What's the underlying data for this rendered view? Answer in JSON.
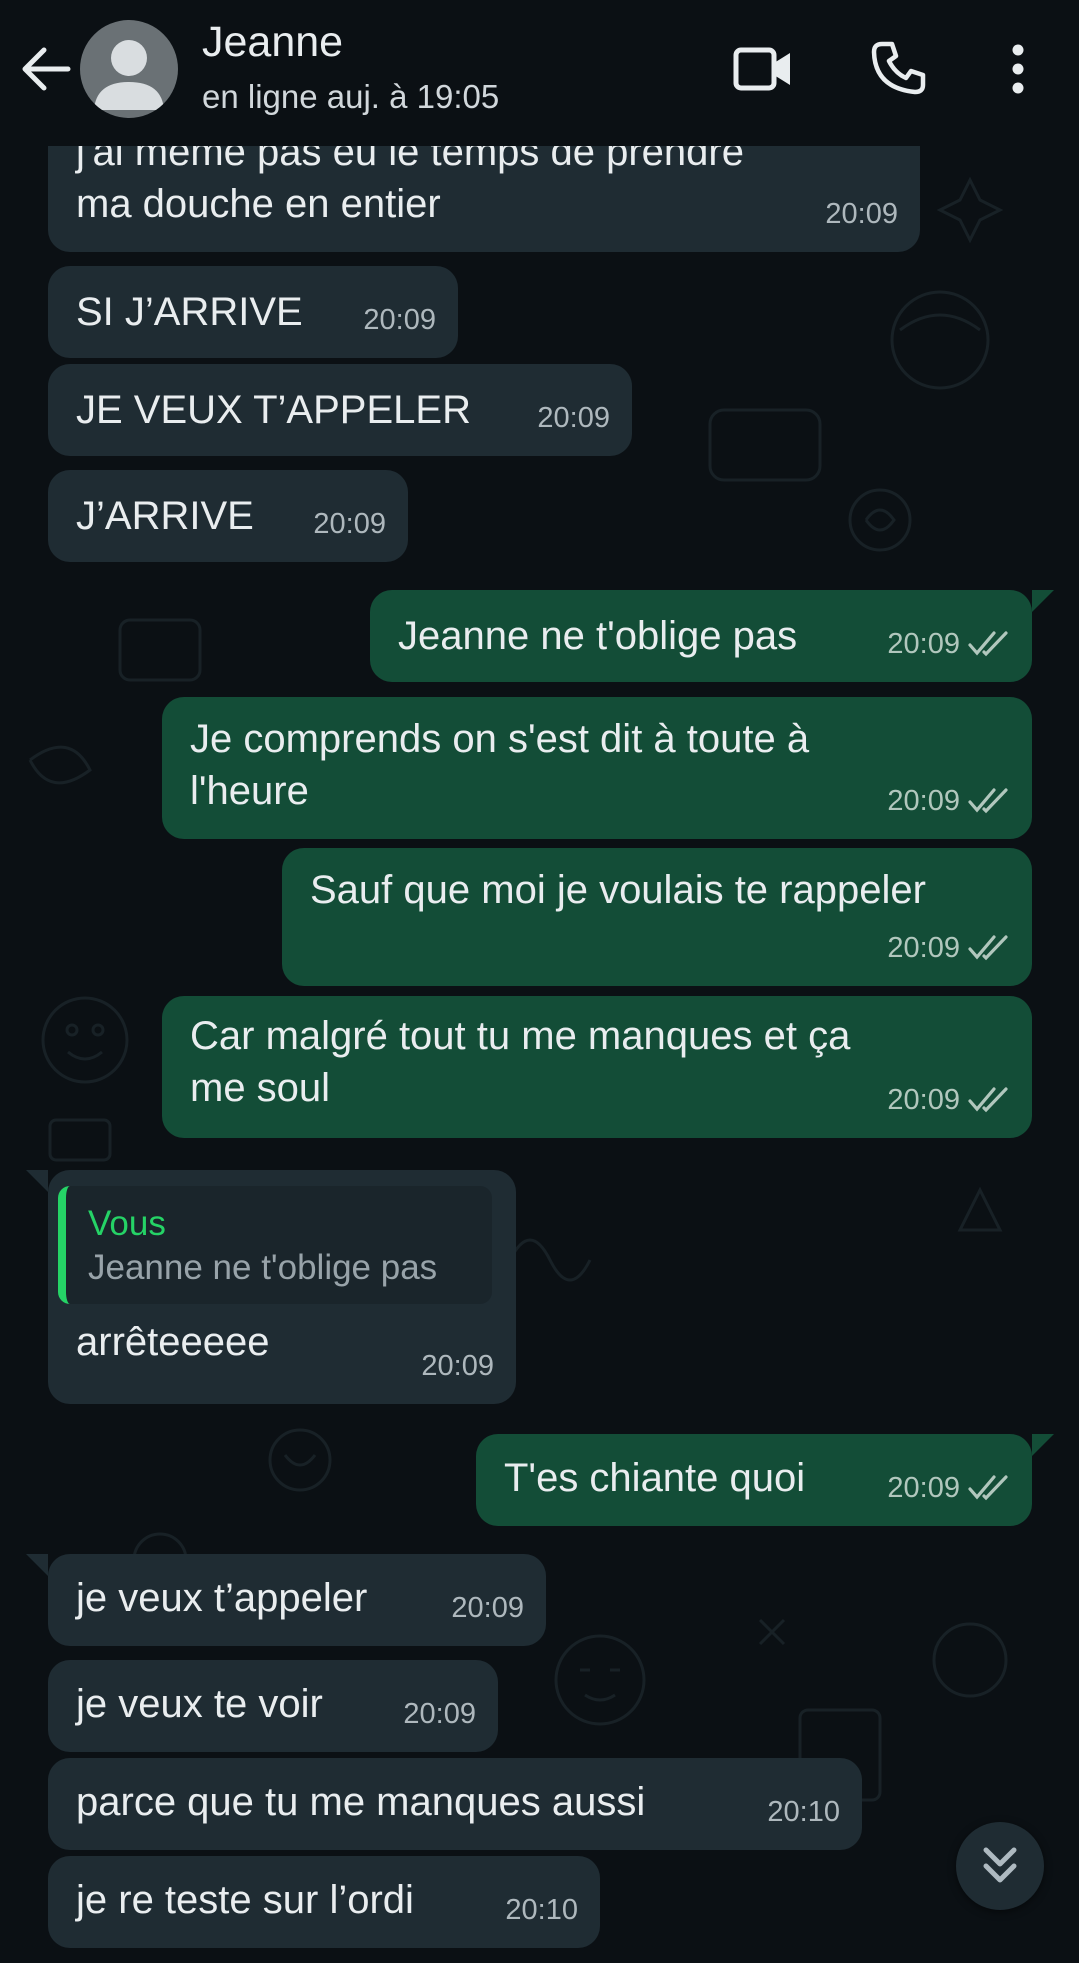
{
  "header": {
    "contact_name": "Jeanne",
    "status": "en ligne auj. à 19:05",
    "icons": [
      "back-arrow-icon",
      "avatar",
      "video-call-icon",
      "phone-call-icon",
      "more-options-icon"
    ]
  },
  "messages": [
    {
      "direction": "in",
      "lines": [
        "j'ai même pas eu le temps de prendre",
        "ma douche en entier"
      ],
      "time": "20:09"
    },
    {
      "direction": "in",
      "lines": [
        "SI J’ARRIVE"
      ],
      "time": "20:09"
    },
    {
      "direction": "in",
      "lines": [
        "JE VEUX T’APPELER"
      ],
      "time": "20:09"
    },
    {
      "direction": "in",
      "lines": [
        "J’ARRIVE"
      ],
      "time": "20:09"
    },
    {
      "direction": "out",
      "lines": [
        "Jeanne ne t'oblige pas"
      ],
      "time": "20:09",
      "status": "read"
    },
    {
      "direction": "out",
      "lines": [
        "Je comprends on s'est dit à toute à",
        "l'heure"
      ],
      "time": "20:09",
      "status": "read"
    },
    {
      "direction": "out",
      "lines": [
        "Sauf que moi je voulais te rappeler"
      ],
      "time": "20:09",
      "status": "read"
    },
    {
      "direction": "out",
      "lines": [
        "Car malgré tout tu me manques et ça",
        "me soul"
      ],
      "time": "20:09",
      "status": "read"
    },
    {
      "direction": "in",
      "quote": {
        "author": "Vous",
        "text": "Jeanne ne t'oblige pas"
      },
      "lines": [
        "arrêteeeee"
      ],
      "time": "20:09"
    },
    {
      "direction": "out",
      "lines": [
        "T'es chiante quoi"
      ],
      "time": "20:09",
      "status": "read"
    },
    {
      "direction": "in",
      "lines": [
        "je veux t’appeler"
      ],
      "time": "20:09"
    },
    {
      "direction": "in",
      "lines": [
        "je veux te voir"
      ],
      "time": "20:09"
    },
    {
      "direction": "in",
      "lines": [
        "parce que tu me manques aussi"
      ],
      "time": "20:10"
    },
    {
      "direction": "in",
      "lines": [
        "je re teste sur l’ordi"
      ],
      "time": "20:10"
    }
  ],
  "colors": {
    "background": "#0b1014",
    "incoming_bubble": "#1f2c33",
    "outgoing_bubble": "#134d37",
    "quote_accent": "#25d366",
    "read_ticks": "#aebac1"
  },
  "scroll_button_icon": "double-chevron-down-icon"
}
